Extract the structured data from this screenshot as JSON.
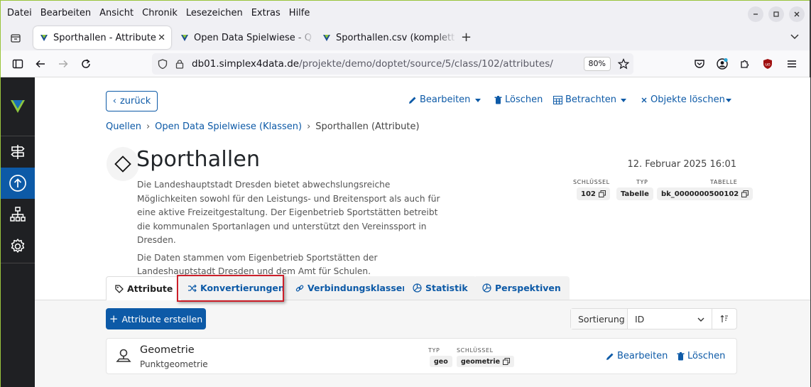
{
  "browser": {
    "menu": [
      "Datei",
      "Bearbeiten",
      "Ansicht",
      "Chronik",
      "Lesezeichen",
      "Extras",
      "Hilfe"
    ],
    "tabs": [
      {
        "label": "Sporthallen - Attribute",
        "active": true
      },
      {
        "label": "Open Data Spielwiese - Q",
        "active": false
      },
      {
        "label": "Sporthallen.csv (komplett",
        "active": false
      }
    ],
    "url_host": "db01.simplex4data.de",
    "url_path": "/projekte/demo/doptet/source/5/class/102/attributes/",
    "zoom": "80%"
  },
  "toolbar": {
    "back_label": "zurück",
    "edit_label": "Bearbeiten",
    "delete_label": "Löschen",
    "view_label": "Betrachten",
    "delete_objects_label": "Objekte löschen"
  },
  "breadcrumb": {
    "items": [
      "Quellen",
      "Open Data Spielwiese (Klassen)"
    ],
    "current": "Sporthallen (Attribute)"
  },
  "header": {
    "title": "Sporthallen",
    "timestamp": "12. Februar 2025 16:01",
    "description": [
      "Die Landeshauptstadt Dresden bietet abwechslungsreiche Möglichkeiten sowohl für den Leistungs- und Breitensport als auch für eine aktive Freizeitgestaltung. Der Eigenbetrieb Sportstätten betreibt die kommunalen Sportanlagen und unterstützt den Vereinssport in Dresden.",
      "Die Daten stammen vom Eigenbetrieb Sportstätten der Landeshauptstadt Dresden und dem Amt für Schulen."
    ],
    "meta": {
      "key_label": "Schlüssel",
      "key_value": "102",
      "type_label": "Typ",
      "type_value": "Tabelle",
      "table_label": "Tabelle",
      "table_value": "bk_0000000500102"
    }
  },
  "tabs": [
    {
      "label": "Attribute",
      "icon": "tag-icon",
      "active": true
    },
    {
      "label": "Konvertierungen",
      "icon": "shuffle-icon",
      "active": false
    },
    {
      "label": "Verbindungsklassen",
      "icon": "link-icon",
      "active": false
    },
    {
      "label": "Statistik",
      "icon": "pie-chart-icon",
      "active": false
    },
    {
      "label": "Perspektiven",
      "icon": "pie-chart-icon",
      "active": false
    }
  ],
  "panel": {
    "create_label": "Attribute erstellen",
    "sort_label": "Sortierung",
    "sort_value": "ID"
  },
  "attributes": [
    {
      "name": "Geometrie",
      "subtitle": "Punktgeometrie",
      "type_label": "Typ",
      "type_value": "geo",
      "key_label": "Schlüssel",
      "key_value": "geometrie",
      "edit_label": "Bearbeiten",
      "delete_label": "Löschen"
    }
  ],
  "colors": {
    "accent": "#0d5aa7",
    "sidebar": "#1f2023",
    "highlight": "#cc1f2a"
  }
}
